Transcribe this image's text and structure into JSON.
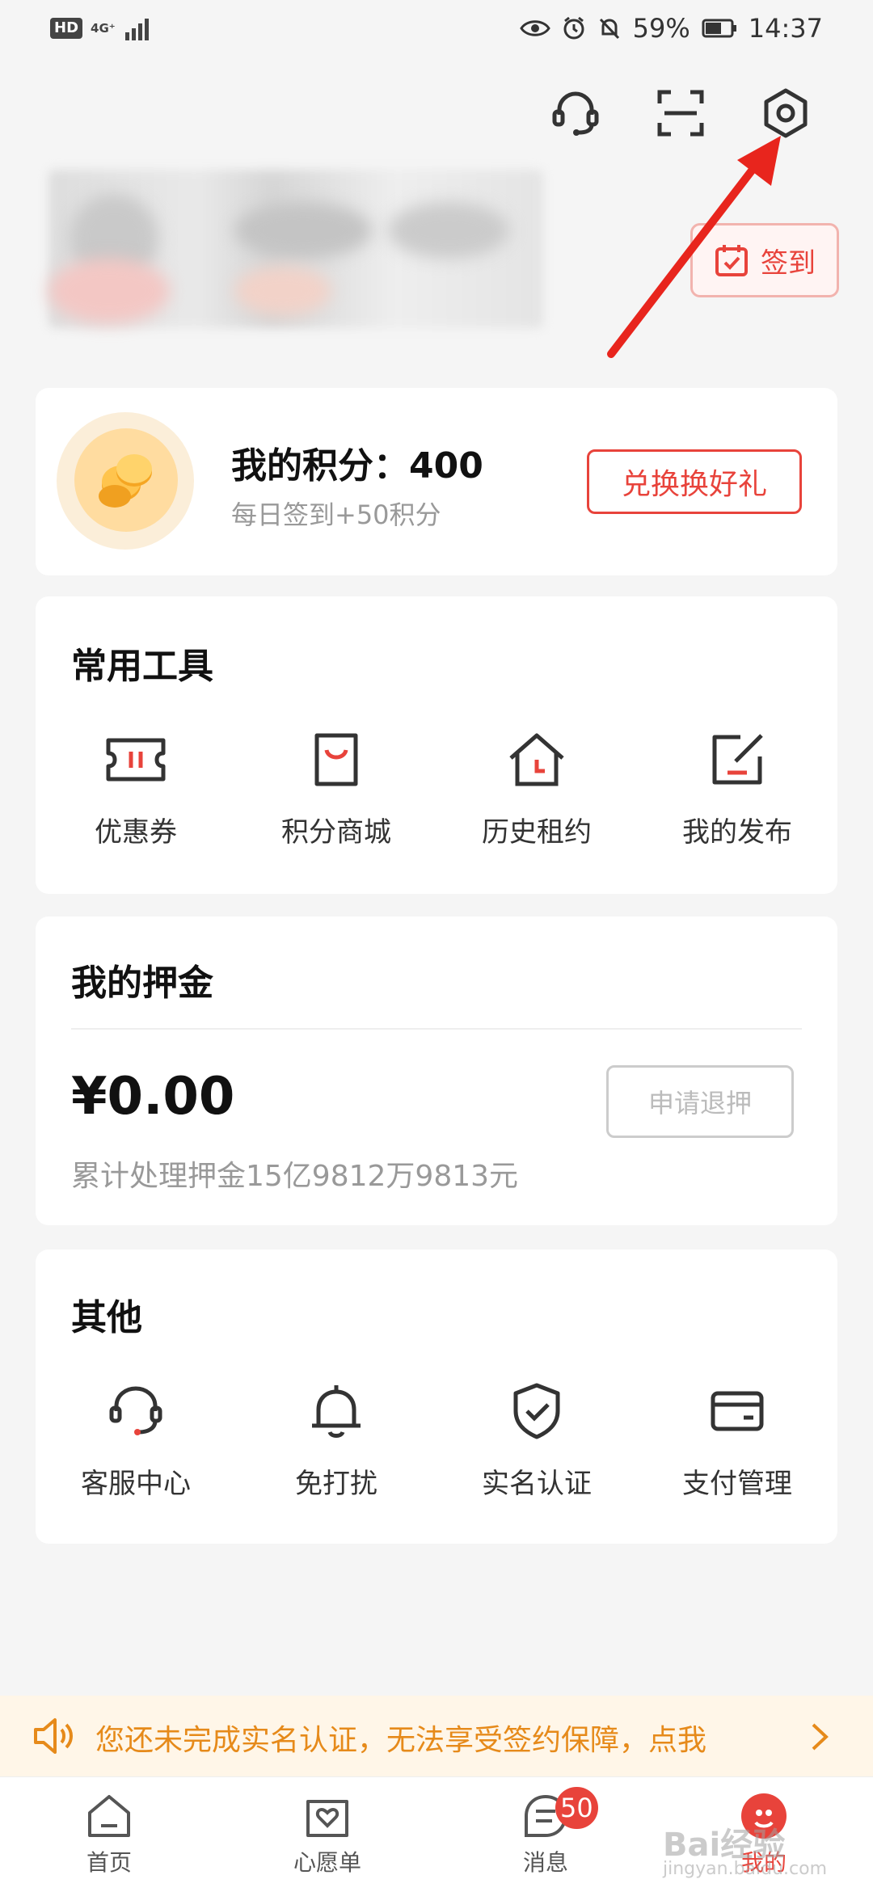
{
  "status_bar": {
    "hd": "HD",
    "network": "4G⁺",
    "battery_percent": "59%",
    "time": "14:37"
  },
  "header": {
    "icons": [
      "headset-icon",
      "scan-icon",
      "settings-icon"
    ],
    "signin_label": "签到"
  },
  "points": {
    "title": "我的积分：400",
    "subtitle": "每日签到+50积分",
    "redeem_label": "兑换换好礼"
  },
  "tools": {
    "title": "常用工具",
    "items": [
      {
        "label": "优惠券",
        "icon": "ticket-icon"
      },
      {
        "label": "积分商城",
        "icon": "shopping-bag-icon"
      },
      {
        "label": "历史租约",
        "icon": "house-clock-icon"
      },
      {
        "label": "我的发布",
        "icon": "edit-icon"
      }
    ]
  },
  "deposit": {
    "title": "我的押金",
    "amount": "¥0.00",
    "note": "累计处理押金15亿9812万9813元",
    "refund_label": "申请退押"
  },
  "other": {
    "title": "其他",
    "items": [
      {
        "label": "客服中心",
        "icon": "headset-icon"
      },
      {
        "label": "免打扰",
        "icon": "bell-icon"
      },
      {
        "label": "实名认证",
        "icon": "shield-check-icon"
      },
      {
        "label": "支付管理",
        "icon": "card-icon"
      }
    ]
  },
  "notice": {
    "text": "您还未完成实名认证，无法享受签约保障，点我"
  },
  "tabbar": {
    "items": [
      {
        "label": "首页"
      },
      {
        "label": "心愿单"
      },
      {
        "label": "消息",
        "badge": "50"
      },
      {
        "label": "我的"
      }
    ]
  },
  "watermark": {
    "text": "Bai经验",
    "sub": "jingyan.baidu.com"
  },
  "colors": {
    "accent": "#e8433b",
    "notice": "#e68a1a",
    "background": "#f5f5f5"
  }
}
